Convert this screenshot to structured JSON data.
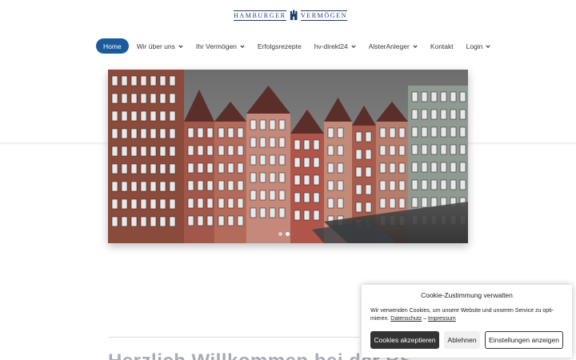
{
  "logo": {
    "left": "HAMBURGER",
    "right": "VERMÖGEN"
  },
  "nav": {
    "items": [
      {
        "label": "Home",
        "active": true,
        "dropdown": false
      },
      {
        "label": "Wir über uns",
        "active": false,
        "dropdown": true
      },
      {
        "label": "Ihr Vermögen",
        "active": false,
        "dropdown": true
      },
      {
        "label": "Erfolgsrezepte",
        "active": false,
        "dropdown": false
      },
      {
        "label": "hv-direkt24",
        "active": false,
        "dropdown": true
      },
      {
        "label": "AlsterAnleger",
        "active": false,
        "dropdown": true
      },
      {
        "label": "Kontakt",
        "active": false,
        "dropdown": false
      },
      {
        "label": "Login",
        "active": false,
        "dropdown": true
      }
    ]
  },
  "slider": {
    "slide_count": 2,
    "active_slide": 2
  },
  "headline": "Herzlich Willkommen bei der BS...",
  "cookie": {
    "title": "Cookie-Zustimmung verwalten",
    "text": "Wir verwenden Cookies, um unsere Website und unseren Service zu opti-mieren.",
    "privacy_link": "Datenschutz",
    "separator": "–",
    "imprint_link": "Impressum",
    "accept": "Cookies akzeptieren",
    "deny": "Ablehnen",
    "settings": "Einstellungen anzeigen"
  },
  "colors": {
    "accent": "#1b5b9b",
    "logo": "#1f3a6e",
    "dark_button": "#333333"
  }
}
